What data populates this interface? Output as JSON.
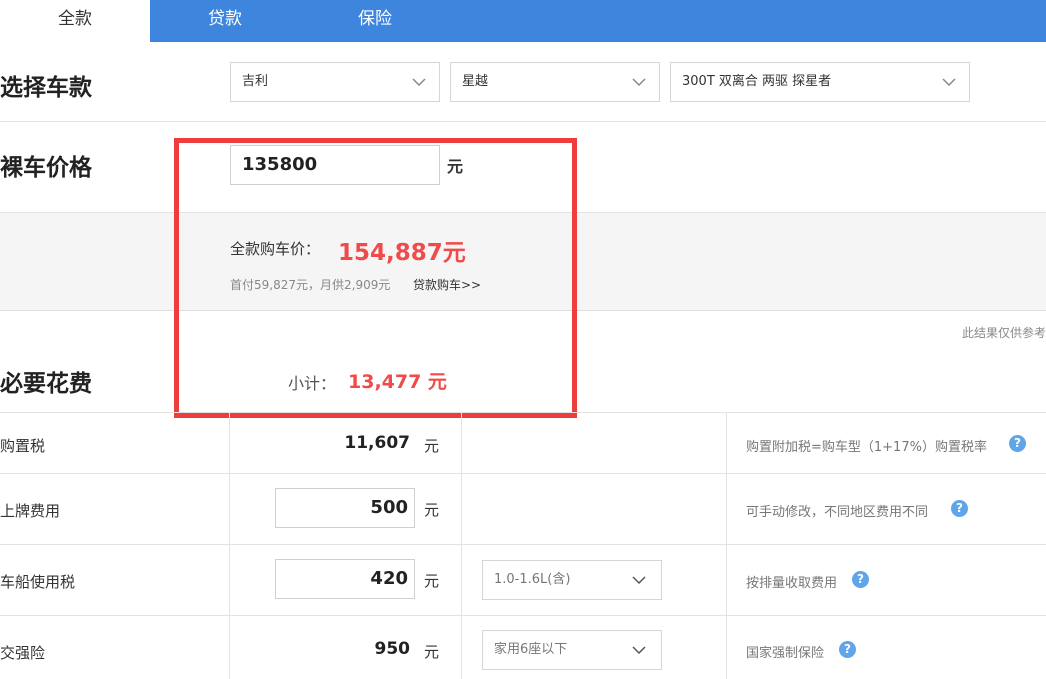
{
  "tabs": [
    {
      "label": "全款"
    },
    {
      "label": "贷款"
    },
    {
      "label": "保险"
    }
  ],
  "car_select": {
    "title": "选择车款",
    "brand": "吉利",
    "series": "星越",
    "model": "300T 双离合 两驱 探星者"
  },
  "bare_price": {
    "title": "裸车价格",
    "value": "135800",
    "unit": "元"
  },
  "full_payment": {
    "label": "全款购车价：",
    "value": "154,887元",
    "sub_text": "首付59,827元，月供2,909元",
    "loan_link": "贷款购车>>"
  },
  "note": "此结果仅供参考",
  "required_fees": {
    "title": "必要花费",
    "subtotal_label": "小计：",
    "subtotal_value": "13,477 元"
  },
  "fee_rows": [
    {
      "label": "购置税",
      "value": "11,607",
      "unit": "元",
      "desc": "购置附加税=购车型（1+17%）购置税率"
    },
    {
      "label": "上牌费用",
      "value": "500",
      "unit": "元",
      "desc": "可手动修改，不同地区费用不同"
    },
    {
      "label": "车船使用税",
      "value": "420",
      "unit": "元",
      "option": "1.0-1.6L(含)",
      "desc": "按排量收取费用"
    },
    {
      "label": "交强险",
      "value": "950",
      "unit": "元",
      "option": "家用6座以下",
      "desc": "国家强制保险"
    }
  ],
  "colors": {
    "tab_blue": "#3e86dd",
    "highlight_red": "#f04a4a",
    "annotation_red": "#ee3d3d",
    "help_blue": "#5ea5ea"
  }
}
